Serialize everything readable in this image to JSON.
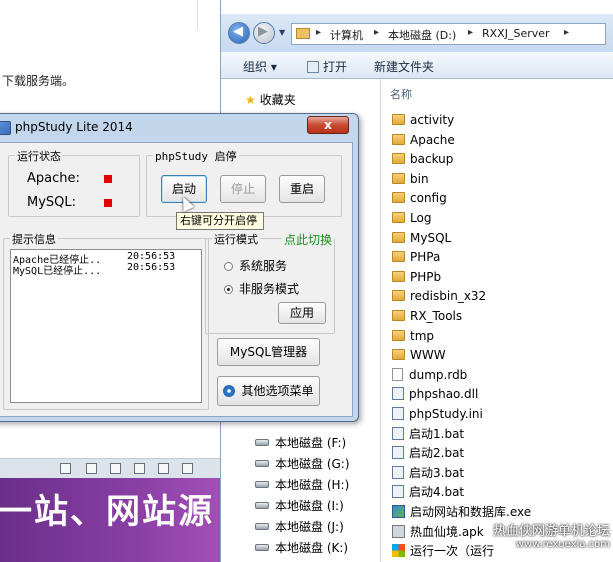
{
  "doc": {
    "text": "下载服务端。",
    "banner_text": "一站、网站源"
  },
  "explorer": {
    "breadcrumbs": [
      "计算机",
      "本地磁盘 (D:)",
      "RXXJ_Server"
    ],
    "commands": {
      "organize": "组织 ▾",
      "open": "打开",
      "new_folder": "新建文件夹"
    },
    "favorites": "收藏夹",
    "column_name": "名称",
    "drives": [
      "本地磁盘 (F:)",
      "本地磁盘 (G:)",
      "本地磁盘 (H:)",
      "本地磁盘 (I:)",
      "本地磁盘 (J:)",
      "本地磁盘 (K:)"
    ],
    "files": [
      {
        "name": "activity",
        "type": "folder"
      },
      {
        "name": "Apache",
        "type": "folder"
      },
      {
        "name": "backup",
        "type": "folder"
      },
      {
        "name": "bin",
        "type": "folder"
      },
      {
        "name": "config",
        "type": "folder"
      },
      {
        "name": "Log",
        "type": "folder"
      },
      {
        "name": "MySQL",
        "type": "folder"
      },
      {
        "name": "PHPa",
        "type": "folder"
      },
      {
        "name": "PHPb",
        "type": "folder"
      },
      {
        "name": "redisbin_x32",
        "type": "folder"
      },
      {
        "name": "RX_Tools",
        "type": "folder"
      },
      {
        "name": "tmp",
        "type": "folder"
      },
      {
        "name": "WWW",
        "type": "folder"
      },
      {
        "name": "dump.rdb",
        "type": "doc"
      },
      {
        "name": "phpshao.dll",
        "type": "cfg"
      },
      {
        "name": "phpStudy.ini",
        "type": "cfg"
      },
      {
        "name": "启动1.bat",
        "type": "cfg"
      },
      {
        "name": "启动2.bat",
        "type": "cfg"
      },
      {
        "name": "启动3.bat",
        "type": "cfg"
      },
      {
        "name": "启动4.bat",
        "type": "cfg"
      },
      {
        "name": "启动网站和数据库.exe",
        "type": "exe"
      },
      {
        "name": "热血仙境.apk",
        "type": "apk"
      },
      {
        "name": "运行一次（运行",
        "type": "win"
      }
    ],
    "watermark_1": "热血侠网游单机论坛",
    "watermark_2": "www.rexuexia.com"
  },
  "dialog": {
    "title": "phpStudy Lite 2014",
    "close": "x",
    "status_group": "运行状态",
    "apache_label": "Apache:",
    "mysql_label": "MySQL:",
    "control_group": "phpStudy 启停",
    "start": "启动",
    "stop": "停止",
    "restart": "重启",
    "tooltip": "右键可分开启停",
    "info_group": "提示信息",
    "log": [
      {
        "msg": "Apache已经停止..",
        "time": "20:56:53"
      },
      {
        "msg": "MySQL已经停止...",
        "time": "20:56:53"
      }
    ],
    "mode_group": "运行模式",
    "switch_link": "点此切换",
    "mode_service": "系统服务",
    "mode_nonservice": "非服务模式",
    "apply": "应用",
    "mysql_manager": "MySQL管理器",
    "other_menu": "其他选项菜单"
  },
  "colors": {
    "status_red": "#e00000",
    "dialog_frame": "#c2d6ec",
    "switch_green": "#1a8f1a"
  }
}
